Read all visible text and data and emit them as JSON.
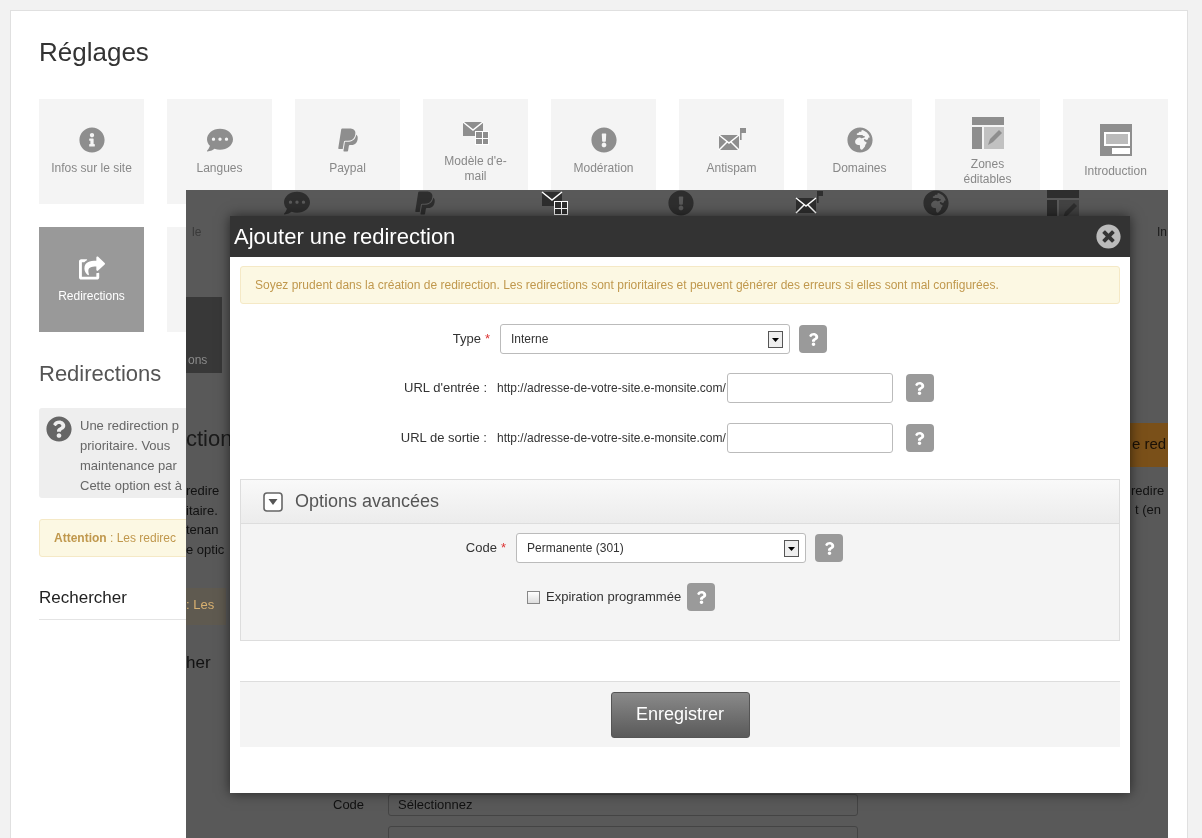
{
  "page": {
    "title": "Réglages"
  },
  "tiles": [
    {
      "label": "Infos sur le site",
      "kind": "info",
      "selected": false
    },
    {
      "label": "Langues",
      "kind": "chat",
      "selected": false
    },
    {
      "label": "Paypal",
      "kind": "paypal",
      "selected": false
    },
    {
      "label": "Modèle d'e-mail",
      "kind": "mail-grid",
      "selected": false
    },
    {
      "label": "Modération",
      "kind": "alert",
      "selected": false
    },
    {
      "label": "Antispam",
      "kind": "mail-flag",
      "selected": false
    },
    {
      "label": "Domaines",
      "kind": "globe",
      "selected": false
    },
    {
      "label": "Zones éditables",
      "kind": "zones",
      "selected": false
    },
    {
      "label": "Introduction",
      "kind": "intro",
      "selected": false
    },
    {
      "label": "Redirections",
      "kind": "share",
      "selected": true
    },
    {
      "selected": false
    }
  ],
  "section": {
    "title": "Redirections",
    "info_lines": [
      "Une redirection p",
      "prioritaire. Vous",
      "maintenance par",
      "Cette option est à"
    ],
    "attention": "**Attention** : Les redirec",
    "search_title": "Rechercher"
  },
  "background_fragments": [
    {
      "text": "le"
    },
    {
      "text": "ons"
    },
    {
      "text": "ction"
    },
    {
      "text": "redire"
    },
    {
      "text": "itaire."
    },
    {
      "text": "tenan"
    },
    {
      "text": "e optic"
    },
    {
      "text": ": Les"
    },
    {
      "text": "her"
    },
    {
      "text": "Code"
    },
    {
      "text": "Sélectionnez"
    },
    {
      "text": "In"
    },
    {
      "text": "e red"
    },
    {
      "text": "redire"
    },
    {
      "text": "t (en"
    }
  ],
  "modal": {
    "title": "Ajouter une redirection",
    "warning": "Soyez prudent dans la création de redirection. Les redirections sont prioritaires et peuvent générer des erreurs si elles sont mal configurées.",
    "fields": [
      {
        "kind": "select",
        "label": "Type",
        "required_mark": "*",
        "value": "Interne"
      },
      {
        "kind": "url",
        "label": "URL d'entrée :",
        "prefix": "http://adresse-de-votre-site.e-monsite.com/"
      },
      {
        "kind": "url",
        "label": "URL de sortie :",
        "prefix": "http://adresse-de-votre-site.e-monsite.com/"
      }
    ],
    "advanced": {
      "title": "Options avancées",
      "expanded": true,
      "code": {
        "label": "Code",
        "required_mark": "*",
        "value": "Permanente (301)"
      },
      "expiration": {
        "label": "Expiration programmée",
        "checked": false
      }
    },
    "submit": "Enregistrer"
  }
}
